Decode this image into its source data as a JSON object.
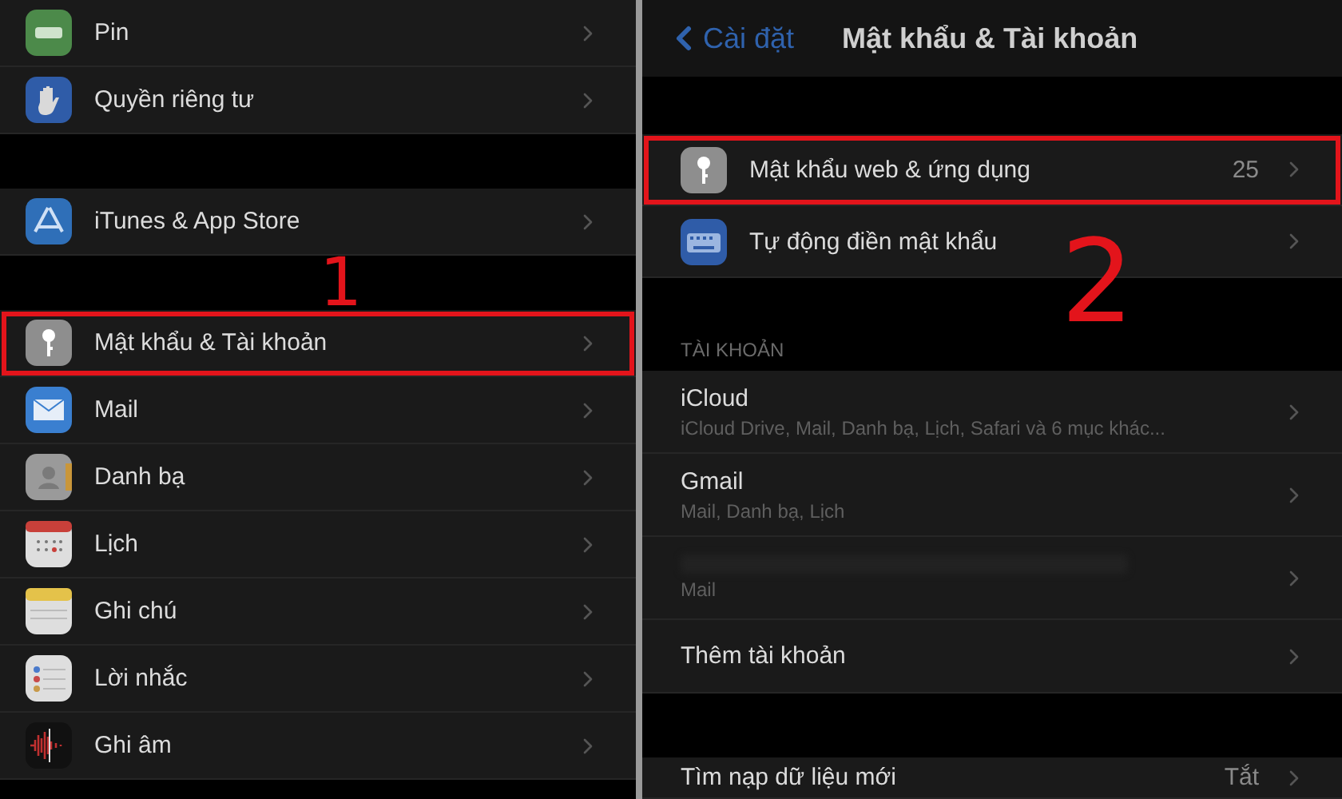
{
  "left_panel": {
    "groups": [
      {
        "items": [
          {
            "label": "Pin",
            "highlighted": false
          },
          {
            "label": "Quyền riêng tư",
            "highlighted": false
          }
        ]
      },
      {
        "items": [
          {
            "label": "iTunes & App Store",
            "highlighted": false
          }
        ]
      },
      {
        "items": [
          {
            "label": "Mật khẩu & Tài khoản",
            "highlighted": true
          },
          {
            "label": "Mail",
            "highlighted": false
          },
          {
            "label": "Danh bạ",
            "highlighted": false
          },
          {
            "label": "Lịch",
            "highlighted": false
          },
          {
            "label": "Ghi chú",
            "highlighted": false
          },
          {
            "label": "Lời nhắc",
            "highlighted": false
          },
          {
            "label": "Ghi âm",
            "highlighted": false
          }
        ]
      }
    ]
  },
  "right_panel": {
    "nav_bar": {
      "back_label": "Cài đặt",
      "title": "Mật khẩu & Tài khoản"
    },
    "password_items": [
      {
        "label": "Mật khẩu web & ứng dụng",
        "value": "25",
        "highlighted": true
      },
      {
        "label": "Tự động điền mật khẩu",
        "highlighted": false
      }
    ],
    "accounts_header": "TÀI KHOẢN",
    "accounts": [
      {
        "name": "iCloud",
        "detail": "iCloud Drive, Mail, Danh bạ, Lịch, Safari và 6 mục khác...",
        "redacted": false
      },
      {
        "name": "Gmail",
        "detail": "Mail, Danh bạ, Lịch",
        "redacted": false
      },
      {
        "detail": "Mail",
        "redacted": true
      },
      {
        "name": "Thêm tài khoản",
        "redacted": false
      }
    ],
    "fetch_row": {
      "label": "Tìm nạp dữ liệu mới",
      "value": "Tắt"
    }
  },
  "annotations": [
    {
      "label": "1"
    },
    {
      "label": "2"
    }
  ]
}
